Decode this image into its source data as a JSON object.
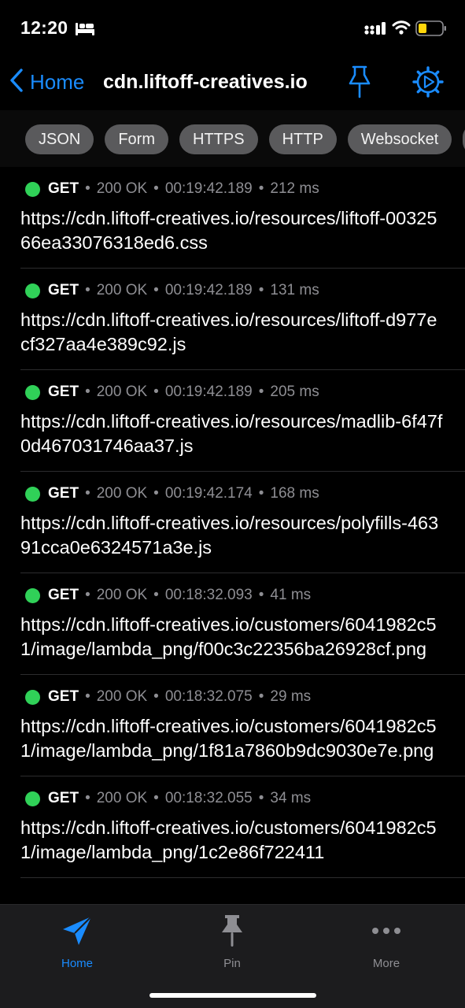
{
  "status_bar": {
    "time": "12:20"
  },
  "header": {
    "back_label": "Home",
    "title": "cdn.liftoff-creatives.io"
  },
  "filters": [
    "JSON",
    "Form",
    "HTTPS",
    "HTTP",
    "Websocket"
  ],
  "requests": [
    {
      "method": "GET",
      "status": "200 OK",
      "time": "00:19:42.189",
      "duration": "212 ms",
      "url": "https://cdn.liftoff-creatives.io/resources/liftoff-0032566ea33076318ed6.css"
    },
    {
      "method": "GET",
      "status": "200 OK",
      "time": "00:19:42.189",
      "duration": "131 ms",
      "url": "https://cdn.liftoff-creatives.io/resources/liftoff-d977ecf327aa4e389c92.js"
    },
    {
      "method": "GET",
      "status": "200 OK",
      "time": "00:19:42.189",
      "duration": "205 ms",
      "url": "https://cdn.liftoff-creatives.io/resources/madlib-6f47f0d467031746aa37.js"
    },
    {
      "method": "GET",
      "status": "200 OK",
      "time": "00:19:42.174",
      "duration": "168 ms",
      "url": "https://cdn.liftoff-creatives.io/resources/polyfills-46391cca0e6324571a3e.js"
    },
    {
      "method": "GET",
      "status": "200 OK",
      "time": "00:18:32.093",
      "duration": "41 ms",
      "url": "https://cdn.liftoff-creatives.io/customers/6041982c51/image/lambda_png/f00c3c22356ba26928cf.png"
    },
    {
      "method": "GET",
      "status": "200 OK",
      "time": "00:18:32.075",
      "duration": "29 ms",
      "url": "https://cdn.liftoff-creatives.io/customers/6041982c51/image/lambda_png/1f81a7860b9dc9030e7e.png"
    },
    {
      "method": "GET",
      "status": "200 OK",
      "time": "00:18:32.055",
      "duration": "34 ms",
      "url": "https://cdn.liftoff-creatives.io/customers/6041982c51/image/lambda_png/1c2e86f722411"
    }
  ],
  "tabs": [
    {
      "label": "Home",
      "icon": "paper-plane-icon",
      "active": true
    },
    {
      "label": "Pin",
      "icon": "pushpin-icon",
      "active": false
    },
    {
      "label": "More",
      "icon": "ellipsis-icon",
      "active": false
    }
  ],
  "colors": {
    "accent": "#1a8cff",
    "status_ok": "#30d158",
    "chip_bg": "#5a5a5c",
    "background": "#000000",
    "tab_bar_bg": "#1c1c1e"
  }
}
